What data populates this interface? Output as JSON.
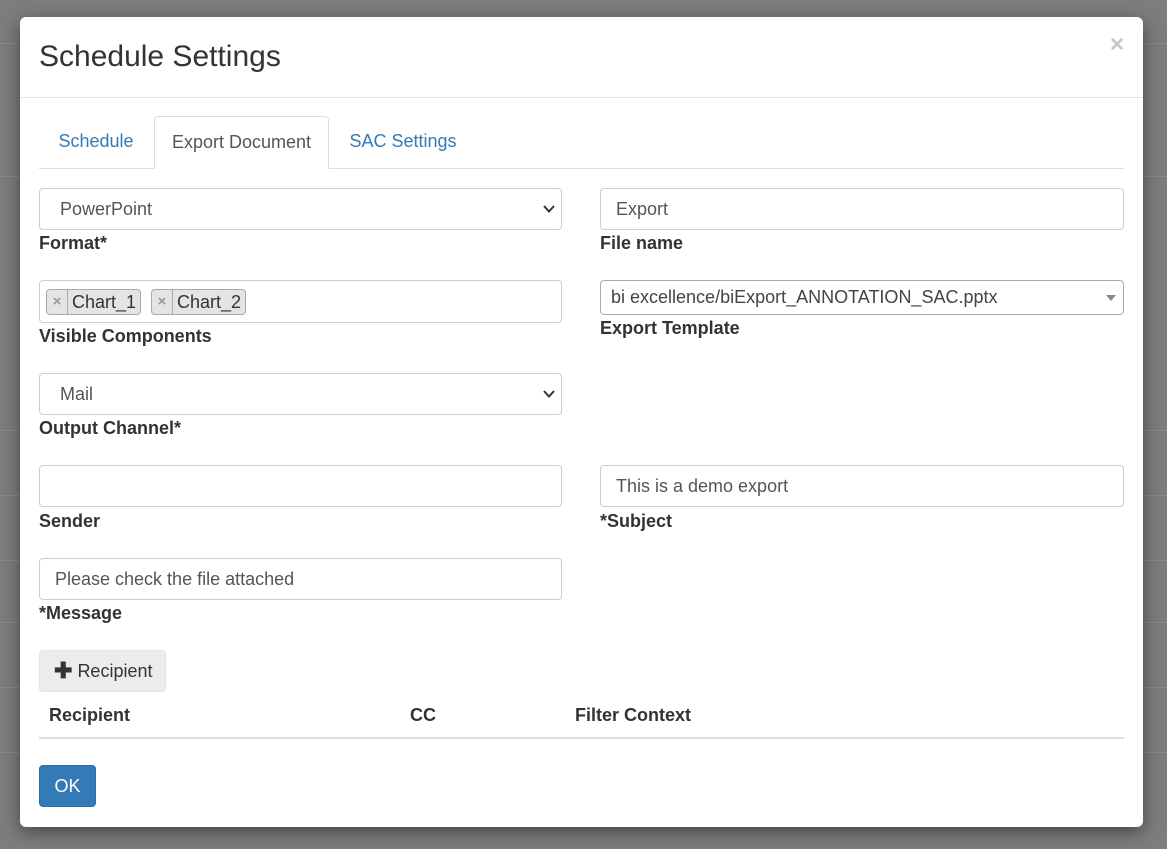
{
  "modal": {
    "title": "Schedule Settings",
    "close_glyph": "×"
  },
  "tabs": [
    {
      "label": "Schedule",
      "active": false
    },
    {
      "label": "Export Document",
      "active": true
    },
    {
      "label": "SAC Settings",
      "active": false
    }
  ],
  "form": {
    "format": {
      "value": "PowerPoint",
      "label": "Format*"
    },
    "file_name": {
      "value": "Export",
      "label": "File name"
    },
    "visible_components": {
      "tags": [
        "Chart_1",
        "Chart_2"
      ],
      "remove_glyph": "×",
      "label": "Visible Components"
    },
    "export_template": {
      "value": "bi excellence/biExport_ANNOTATION_SAC.pptx",
      "label": "Export Template"
    },
    "output_channel": {
      "value": "Mail",
      "label": "Output Channel*"
    },
    "sender": {
      "value": "",
      "label": "Sender"
    },
    "subject": {
      "value": "This is a demo export",
      "label": "*Subject"
    },
    "message": {
      "value": "Please check the file attached",
      "label": "*Message"
    }
  },
  "recipient_button": {
    "icon": "plus-icon",
    "glyph": "✚",
    "label": "Recipient"
  },
  "recipients_table": {
    "columns": [
      "Recipient",
      "CC",
      "Filter Context"
    ]
  },
  "ok_button": {
    "label": "OK"
  },
  "colors": {
    "primary": "#337ab7",
    "link": "#337ab7",
    "backdrop": "#7d7d7d"
  }
}
